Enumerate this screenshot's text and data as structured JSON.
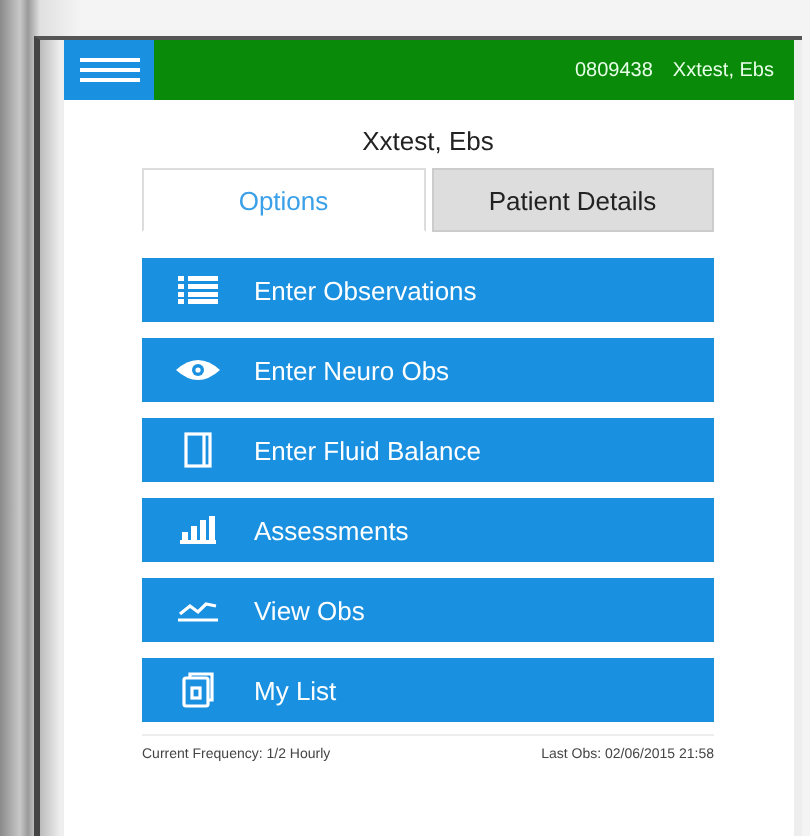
{
  "header": {
    "patient_id": "0809438",
    "patient_name": "Xxtest, Ebs"
  },
  "title": "Xxtest, Ebs",
  "tabs": [
    {
      "label": "Options",
      "selected": true
    },
    {
      "label": "Patient Details",
      "selected": false
    }
  ],
  "actions": [
    {
      "label": "Enter Observations",
      "kind": "list"
    },
    {
      "label": "Enter Neuro Obs",
      "kind": "eye"
    },
    {
      "label": "Enter Fluid Balance",
      "kind": "book"
    },
    {
      "label": "Assessments",
      "kind": "bars"
    },
    {
      "label": "View Obs",
      "kind": "trend"
    },
    {
      "label": "My List",
      "kind": "doc"
    }
  ],
  "footer": {
    "frequency": "Current Frequency: 1/2 Hourly",
    "last_obs": "Last Obs: 02/06/2015 21:58"
  }
}
